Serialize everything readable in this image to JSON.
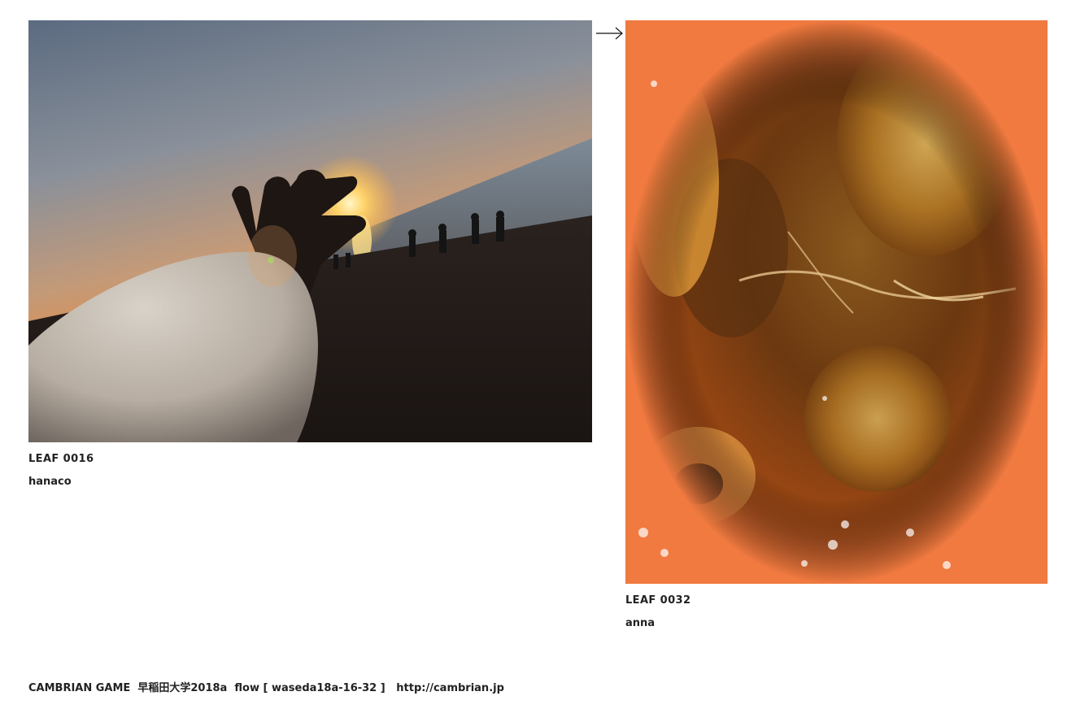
{
  "leaves": [
    {
      "id": "LEAF 0016",
      "author": "hanaco",
      "photo_icon": "sunset-beach-hand-photo"
    },
    {
      "id": "LEAF 0032",
      "author": "anna",
      "photo_icon": "persimmon-closeup-photo"
    }
  ],
  "flow_arrow_icon": "right-arrow-icon",
  "footer": {
    "game": "CAMBRIAN GAME",
    "session": "早稲田大学2018a",
    "flow": "flow [ waseda18a-16-32 ]",
    "url": "http://cambrian.jp"
  },
  "colors": {
    "text": "#222222",
    "background": "#ffffff"
  }
}
